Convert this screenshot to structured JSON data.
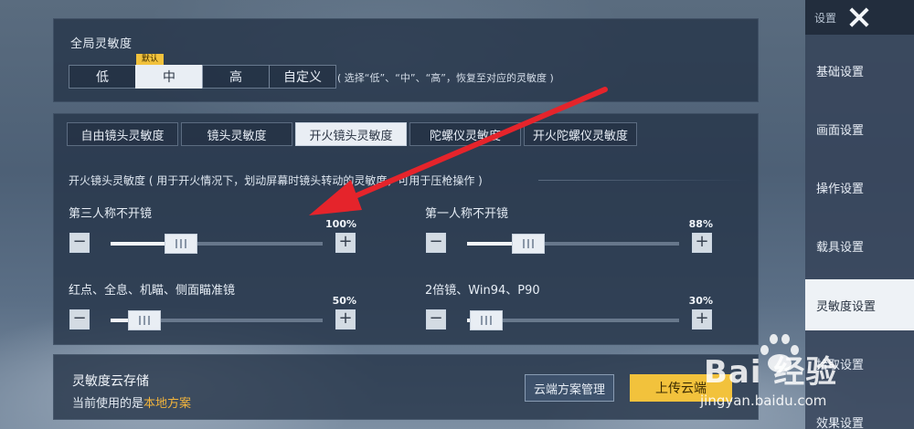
{
  "global": {
    "title": "全局灵敏度",
    "default_tag": "默认",
    "options": [
      "低",
      "中",
      "高",
      "自定义"
    ],
    "selected": "中",
    "hint": "( 选择“低”、“中”、“高”，恢复至对应的灵敏度 )"
  },
  "tabs": [
    "自由镜头灵敏度",
    "镜头灵敏度",
    "开火镜头灵敏度",
    "陀螺仪灵敏度",
    "开火陀螺仪灵敏度"
  ],
  "active_tab": "开火镜头灵敏度",
  "section": {
    "description": "开火镜头灵敏度 ( 用于开火情况下，划动屏幕时镜头转动的灵敏度，可用于压枪操作 )"
  },
  "sliders": [
    {
      "label": "第三人称不开镜",
      "value_text": "100%",
      "level": 0.33
    },
    {
      "label": "第一人称不开镜",
      "value_text": "88%",
      "level": 0.29
    },
    {
      "label": "红点、全息、机瞄、侧面瞄准镜",
      "value_text": "50%",
      "level": 0.16
    },
    {
      "label": "2倍镜、Win94、P90",
      "value_text": "30%",
      "level": 0.09
    }
  ],
  "stepper": {
    "minus": "−",
    "plus": "+"
  },
  "cloud": {
    "title": "灵敏度云存储",
    "current_prefix": "当前使用的是",
    "current_value": "本地方案",
    "manage_label": "云端方案管理",
    "upload_label": "上传云端"
  },
  "sidebar": {
    "header": "设置",
    "items": [
      "基础设置",
      "画面设置",
      "操作设置",
      "载具设置",
      "灵敏度设置",
      "拾取设置",
      "效果设置"
    ],
    "active": "灵敏度设置"
  },
  "watermark": {
    "logo": "Bai 经验",
    "url": "jingyan.baidu.com"
  },
  "colors": {
    "accent": "#f2c23c",
    "active_bg": "#e9eef4",
    "arrow": "#e5242b"
  }
}
